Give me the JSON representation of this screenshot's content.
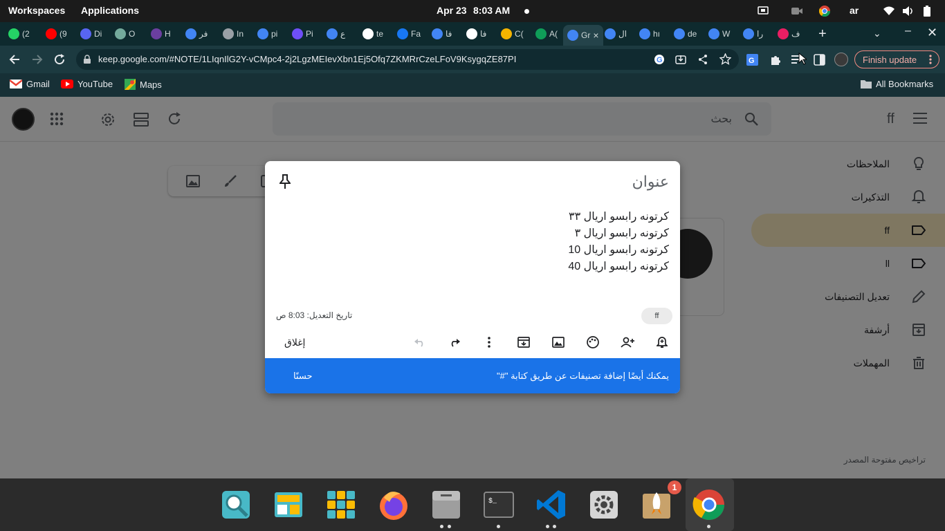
{
  "os": {
    "workspaces": "Workspaces",
    "applications": "Applications",
    "date": "Apr 23",
    "time": "8:03 AM",
    "lang": "ar"
  },
  "tabs": [
    {
      "label": "(2",
      "icon": "whatsapp-icon",
      "color": "#25d366"
    },
    {
      "label": "(9",
      "icon": "youtube-icon",
      "color": "#ff0000"
    },
    {
      "label": "Di",
      "icon": "discord-icon",
      "color": "#5865f2"
    },
    {
      "label": "O",
      "icon": "chatgpt-icon",
      "color": "#74aa9c"
    },
    {
      "label": "H",
      "icon": "terminal-app-icon",
      "color": "#6b3fa0"
    },
    {
      "label": "فر",
      "icon": "google-icon",
      "color": "#4285f4"
    },
    {
      "label": "In",
      "icon": "globe-icon",
      "color": "#9aa0a6"
    },
    {
      "label": "pi",
      "icon": "google-icon",
      "color": "#4285f4"
    },
    {
      "label": "Pi",
      "icon": "chart-icon",
      "color": "#6e4ff6"
    },
    {
      "label": "ع",
      "icon": "google-icon",
      "color": "#4285f4"
    },
    {
      "label": "te",
      "icon": "github-icon",
      "color": "#ffffff"
    },
    {
      "label": "Fa",
      "icon": "facebook-icon",
      "color": "#1877f2"
    },
    {
      "label": "فا",
      "icon": "google-icon",
      "color": "#4285f4"
    },
    {
      "label": "فا",
      "icon": "doc-icon",
      "color": "#ffffff"
    },
    {
      "label": "C(",
      "icon": "app-icon",
      "color": "#f4b400"
    },
    {
      "label": "A(",
      "icon": "app-icon",
      "color": "#0f9d58"
    },
    {
      "label": "Gr",
      "icon": "google-icon",
      "color": "#4285f4",
      "active": true
    },
    {
      "label": "ال",
      "icon": "google-icon",
      "color": "#4285f4"
    },
    {
      "label": "hı",
      "icon": "google-icon",
      "color": "#4285f4"
    },
    {
      "label": "de",
      "icon": "google-icon",
      "color": "#4285f4"
    },
    {
      "label": "W",
      "icon": "google-icon",
      "color": "#4285f4"
    },
    {
      "label": "را",
      "icon": "google-icon",
      "color": "#4285f4"
    },
    {
      "label": "ف",
      "icon": "app-icon",
      "color": "#e91e63"
    }
  ],
  "browser": {
    "url": "keep.google.com/#NOTE/1LIqnIlG2Y-vCMpc4-2j2LgzMEIevXbn1Ej5Ofq7ZKMRrCzeLFoV9KsygqZE87PI",
    "url_host": "keep.google.com",
    "finish_update": "Finish update"
  },
  "bookmarks": [
    {
      "label": "Gmail",
      "icon": "gmail-icon"
    },
    {
      "label": "YouTube",
      "icon": "youtube-icon"
    },
    {
      "label": "Maps",
      "icon": "maps-icon"
    }
  ],
  "all_bookmarks": "All Bookmarks",
  "keep": {
    "app_name": "ff",
    "search_placeholder": "بحث",
    "nav": [
      {
        "label": "الملاحظات",
        "icon": "lightbulb-icon"
      },
      {
        "label": "التذكيرات",
        "icon": "bell-icon"
      },
      {
        "label": "ff",
        "icon": "label-icon",
        "selected": true
      },
      {
        "label": "ll",
        "icon": "label-icon"
      },
      {
        "label": "تعديل التصنيفات",
        "icon": "pencil-icon"
      },
      {
        "label": "أرشفة",
        "icon": "archive-icon"
      },
      {
        "label": "المهملات",
        "icon": "trash-icon"
      }
    ],
    "footer": "تراخيص مفتوحة المصدر"
  },
  "note": {
    "title_placeholder": "عنوان",
    "lines": [
      "كرتونه رابسو اريال ٣٣",
      "كرتونه رابسو اريال ٣",
      "كرتونه رابسو اريال 10",
      "كرتونه رابسو اريال 40"
    ],
    "label_chip": "ff",
    "edited": "تاريخ التعديل: 8:03 ص",
    "close": "إغلاق"
  },
  "snackbar": {
    "message": "يمكنك أيضًا إضافة تصنيفات عن طريق كتابة \"#\"",
    "action": "حسنًا"
  },
  "dock": {
    "updates_badge": "1"
  }
}
